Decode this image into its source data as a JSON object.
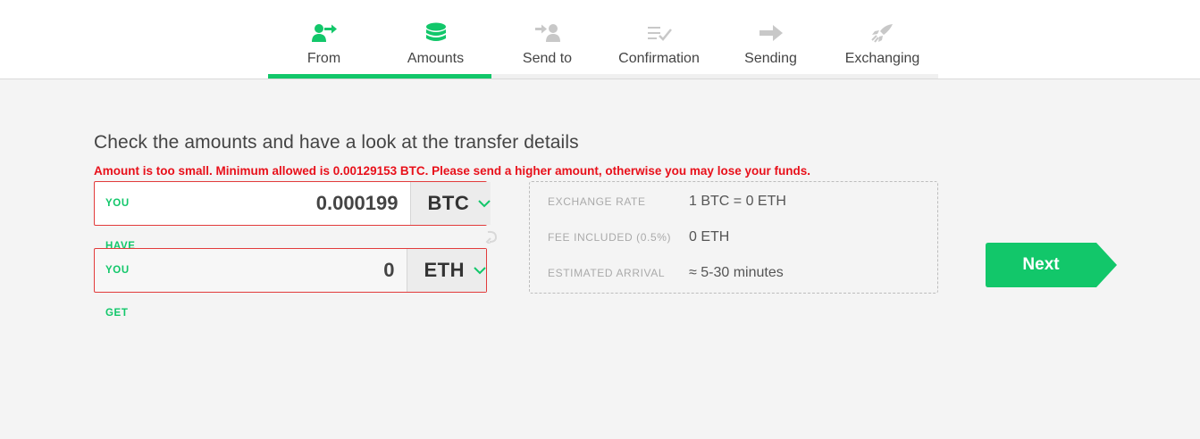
{
  "steps": [
    {
      "label": "From",
      "icon": "user-arrow-icon",
      "state": "done"
    },
    {
      "label": "Amounts",
      "icon": "coins-icon",
      "state": "active"
    },
    {
      "label": "Send to",
      "icon": "arrow-user-icon",
      "state": "pending"
    },
    {
      "label": "Confirmation",
      "icon": "list-check-icon",
      "state": "pending"
    },
    {
      "label": "Sending",
      "icon": "arrow-right-icon",
      "state": "pending"
    },
    {
      "label": "Exchanging",
      "icon": "rocket-icon",
      "state": "pending"
    }
  ],
  "progress_fraction": 0.333,
  "heading": "Check the amounts and have a look at the transfer details",
  "error": "Amount is too small. Minimum allowed is 0.00129153 BTC. Please send a higher amount, otherwise you may lose your funds.",
  "have": {
    "label": "YOU HAVE",
    "value": "0.000199",
    "currency": "BTC"
  },
  "get": {
    "label": "YOU GET",
    "value": "0",
    "currency": "ETH"
  },
  "details": {
    "rate_label": "EXCHANGE RATE",
    "rate_value": "1 BTC = 0 ETH",
    "fee_label": "FEE INCLUDED (0.5%)",
    "fee_value": "0 ETH",
    "arrival_label": "ESTIMATED ARRIVAL",
    "arrival_value": "≈ 5-30 minutes"
  },
  "next_label": "Next",
  "colors": {
    "accent": "#12c76a",
    "inactive": "#c8c8c8",
    "error": "#e8101a"
  }
}
